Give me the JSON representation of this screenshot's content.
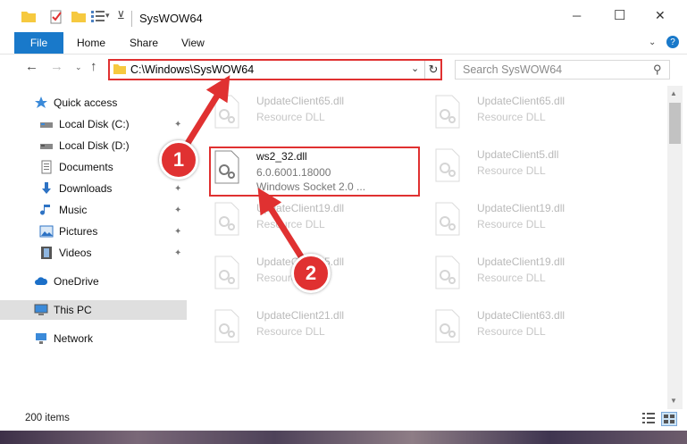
{
  "window": {
    "title": "SysWOW64",
    "minimize_label": "─",
    "maximize_label": "☐",
    "close_label": "✕"
  },
  "ribbon": {
    "tabs": [
      "File",
      "Home",
      "Share",
      "View"
    ],
    "help": "?"
  },
  "address": {
    "path": "C:\\Windows\\SysWOW64",
    "search_placeholder": "Search SysWOW64"
  },
  "nav": {
    "items": [
      {
        "label": "Quick access",
        "icon": "star-icon",
        "pinned": false
      },
      {
        "label": "Local Disk (C:)",
        "icon": "drive-icon",
        "pinned": true
      },
      {
        "label": "Local Disk (D:)",
        "icon": "drive-icon",
        "pinned": false
      },
      {
        "label": "Documents",
        "icon": "documents-icon",
        "pinned": true
      },
      {
        "label": "Downloads",
        "icon": "download-icon",
        "pinned": true
      },
      {
        "label": "Music",
        "icon": "music-icon",
        "pinned": true
      },
      {
        "label": "Pictures",
        "icon": "pictures-icon",
        "pinned": true
      },
      {
        "label": "Videos",
        "icon": "videos-icon",
        "pinned": true
      },
      {
        "label": "OneDrive",
        "icon": "cloud-icon",
        "pinned": false
      },
      {
        "label": "This PC",
        "icon": "computer-icon",
        "pinned": false
      },
      {
        "label": "Network",
        "icon": "network-icon",
        "pinned": false
      }
    ]
  },
  "files": {
    "left": [
      {
        "name": "UpdateClient65.dll",
        "type": "Resource DLL"
      },
      {
        "name": "ws2_32.dll",
        "type": "6.0.6001.18000",
        "desc": "Windows Socket 2.0 ..."
      },
      {
        "name": "UpdateClient19.dll",
        "type": "Resource DLL"
      },
      {
        "name": "UpdateClient65.dll",
        "type": "Resource DLL"
      },
      {
        "name": "UpdateClient21.dll",
        "type": "Resource DLL"
      }
    ],
    "right": [
      {
        "name": "UpdateClient65.dll",
        "type": "Resource DLL"
      },
      {
        "name": "UpdateClient5.dll",
        "type": "Resource DLL"
      },
      {
        "name": "UpdateClient19.dll",
        "type": "Resource DLL"
      },
      {
        "name": "UpdateClient19.dll",
        "type": "Resource DLL"
      },
      {
        "name": "UpdateClient63.dll",
        "type": "Resource DLL"
      }
    ]
  },
  "status": {
    "items_count": "200 items"
  },
  "callouts": [
    "1",
    "2"
  ],
  "colors": {
    "accent": "#1979ca",
    "highlight": "#e03131",
    "folder": "#f6c93f"
  }
}
